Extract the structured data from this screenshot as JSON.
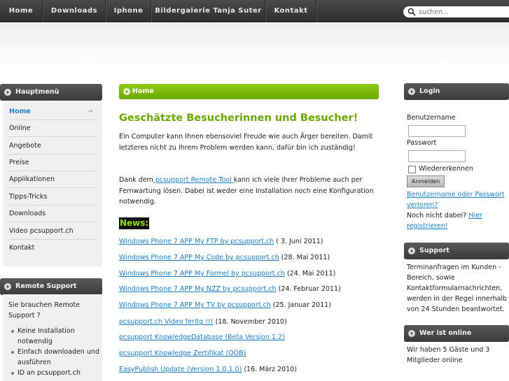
{
  "nav": {
    "items": [
      "Home",
      "Downloads",
      "Iphone",
      "Bildergalerie Tanja Suter",
      "Kontakt"
    ]
  },
  "search": {
    "placeholder": "suchen..."
  },
  "left": {
    "main_menu_title": "Hauptmenü",
    "menu": [
      "Home",
      "Online",
      "Angebote",
      "Preise",
      "Applikationen",
      "Tipps-Tricks",
      "Downloads",
      "Video pcsupport.ch",
      "Kontakt"
    ],
    "active_chevron": "⇒",
    "remote_title": "Remote Support",
    "remote_text": "Sie brauchen Remote Support ?",
    "remote_list": [
      "Keine Installation notwendig",
      "Einfach downloaden und ausführen",
      "ID an pcsupport.ch"
    ]
  },
  "main": {
    "breadcrumb": "Home",
    "headline": "Geschätzte Besucherinnen und Besucher!",
    "para1": "Ein Computer kann Ihnen ebensoviel Freude wie auch Ärger bereiten. Damit letzteres nicht zu Ihrem Problem werden kann, dafür bin ich zuständig!",
    "para2_before": "Dank dem",
    "para2_link": " pcsupport Remote Tool ",
    "para2_after": "kann ich viele Ihrer Probleme auch per Fernwartung lösen. Dabei ist weder eine Installation noch eine Konfiguration notwendig.",
    "news_label": "News:",
    "news": [
      {
        "link": "Windows Phone 7 APP My FTP by pcsupport.ch",
        "date": " ( 3. Juni 2011)"
      },
      {
        "link": "Windows Phone 7 APP My Code by pcsupport.ch",
        "date": " (28. Mai 2011)"
      },
      {
        "link": "Windows Phone 7 APP My Formel by pcsupport.ch",
        "date": " (24. Mai 2011)"
      },
      {
        "link": "Windows Phone 7 APP My NZZ by pcsupport.ch",
        "date": " (24. Februar 2011)"
      },
      {
        "link": "Windows Phone 7 APP My TV by pcsupport.ch",
        "date": " (25. Januar 2011)"
      },
      {
        "link": "pcsupport.ch Video feritg !!!",
        "date": " (18. November 2010)"
      },
      {
        "link": "pcsupport KnowledgeDatabase (Beta Version 1.2)",
        "date": ""
      },
      {
        "link": "pcsupport Knowledge Zertifikat (OOB)",
        "date": ""
      },
      {
        "link": "EasyPublish Update (Version 1.0.1.0)",
        "date": " (16. März 2010)"
      }
    ]
  },
  "right": {
    "login_title": "Login",
    "username_label": "Benutzername",
    "password_label": "Passwort",
    "remember_label": "Wiedererkennen",
    "login_button": "Anmelden",
    "forgot_link": "Benutzername oder Passwort verloren?",
    "register_text": "Noch nicht dabei?",
    "register_link": "Hier registrieren!",
    "support_title": "Support",
    "support_text": "Terminanfragen im Kunden - Bereich, sowie Kontaktformularnachrichten, werden in der Regel innerhalb von 24 Stunden beantwortet.",
    "online_title": "Wer ist online",
    "online_text": "Wir haben 5 Gäste und 3 Mitglieder online"
  },
  "colors": {
    "accent_green": "#6aa800",
    "link_blue": "#1a7fc8",
    "nav_dark": "#3a3a3a"
  }
}
